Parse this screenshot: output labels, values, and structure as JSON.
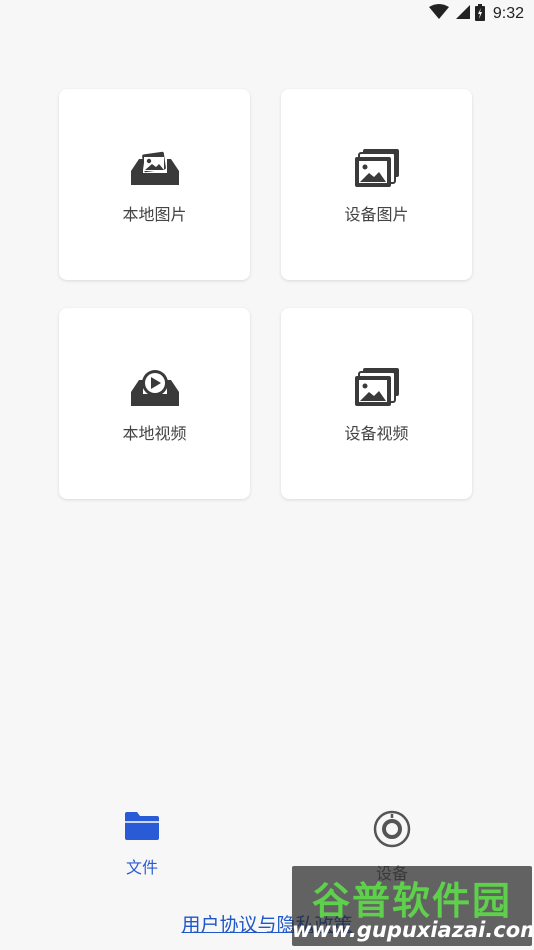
{
  "status_bar": {
    "time": "9:32",
    "icons": [
      "wifi-icon",
      "signal-icon",
      "battery-icon"
    ]
  },
  "cards": [
    {
      "label": "本地图片",
      "icon": "local-image-icon"
    },
    {
      "label": "设备图片",
      "icon": "device-images-icon"
    },
    {
      "label": "本地视频",
      "icon": "local-video-icon"
    },
    {
      "label": "设备视频",
      "icon": "device-videos-icon"
    }
  ],
  "tabbar": {
    "tabs": [
      {
        "label": "文件",
        "icon": "folder-icon",
        "active": true,
        "color": "#2a5bd6"
      },
      {
        "label": "设备",
        "icon": "camera-lens-icon",
        "active": false,
        "color": "#666666"
      }
    ]
  },
  "privacy_link": "用户协议与隐私政策",
  "watermark": {
    "title": "谷普软件园",
    "url": "www.gupuxiazai.com"
  },
  "colors": {
    "accent": "#2a5bd6",
    "icon_dark": "#3a3a3a",
    "background": "#f7f7f7",
    "card": "#ffffff"
  }
}
